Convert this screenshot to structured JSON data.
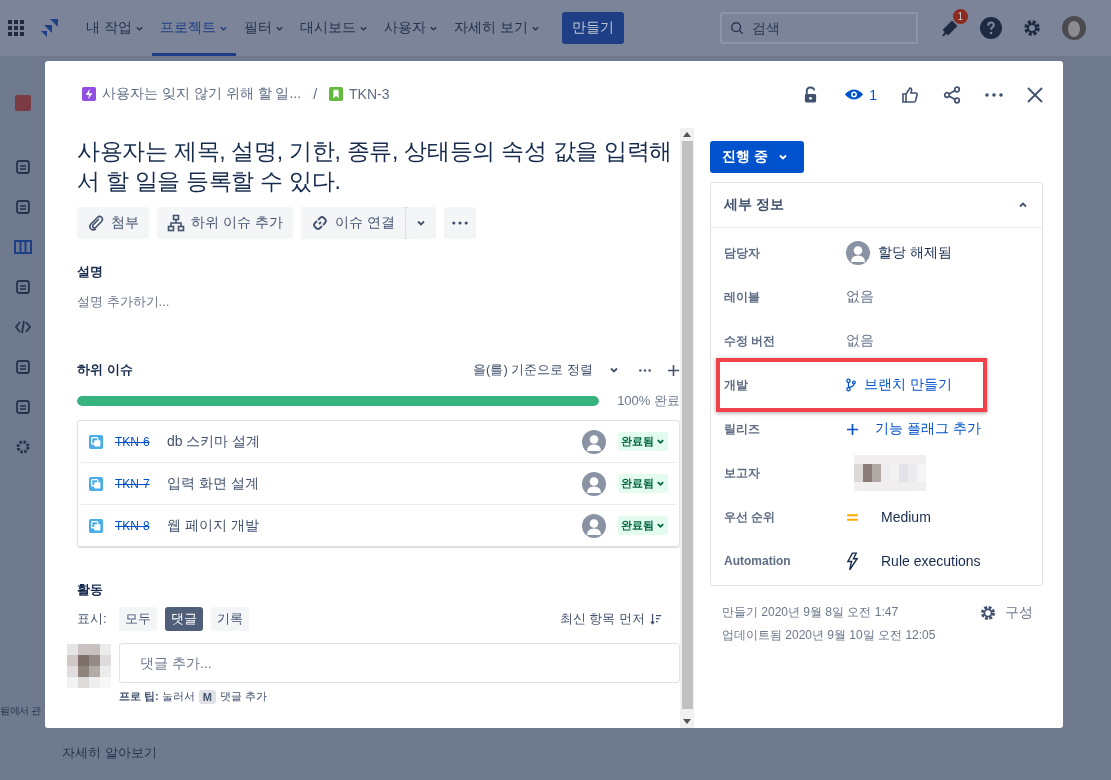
{
  "top_nav": {
    "menus": [
      {
        "label": "내 작업",
        "selected": false
      },
      {
        "label": "프로젝트",
        "selected": true
      },
      {
        "label": "필터",
        "selected": false
      },
      {
        "label": "대시보드",
        "selected": false
      },
      {
        "label": "사용자",
        "selected": false
      },
      {
        "label": "자세히 보기",
        "selected": false
      }
    ],
    "create_button": "만들기",
    "search": {
      "placeholder": "검색"
    },
    "notification_count": "1"
  },
  "background_texts": [
    "됨에서 관",
    "자세히 알아보기"
  ],
  "issue": {
    "breadcrumb": [
      {
        "kind": "epic",
        "label": "사용자는 잊지 않기 위해 할 일..."
      },
      {
        "kind": "story",
        "label": "TKN-3"
      }
    ],
    "breadcrumb_separator": "/",
    "watchers": "1",
    "title": "사용자는 제목, 설명, 기한, 종류, 상태등의 속성 값을 입력해서 할 일을 등록할 수 있다.",
    "actions": [
      {
        "kind": "attach",
        "label": "첨부"
      },
      {
        "kind": "subtask",
        "label": "하위 이슈 추가"
      },
      {
        "kind": "link",
        "label": "이슈 연결"
      }
    ],
    "description": {
      "heading": "설명",
      "prompt": "설명 추가하기..."
    },
    "subtasks": {
      "heading": "하위 이슈",
      "sort_label": "을(를) 기준으로 정렬",
      "level": 1,
      "progress_text": "100% 완료",
      "items": [
        {
          "key": "TKN-6",
          "summary": "db 스키마 설계",
          "status": "완료됨",
          "done": true
        },
        {
          "key": "TKN-7",
          "summary": "입력 화면 설계",
          "status": "완료됨",
          "done": true
        },
        {
          "key": "TKN-8",
          "summary": "웹 페이지 개발",
          "status": "완료됨",
          "done": true
        }
      ]
    },
    "activity": {
      "heading": "활동",
      "show_label": "표시:",
      "filters": [
        {
          "label": "모두",
          "selected": false
        },
        {
          "label": "댓글",
          "selected": true
        },
        {
          "label": "기록",
          "selected": false
        }
      ],
      "order_label": "최신 항목 먼저",
      "comment": {
        "placeholder": "댓글 추가..."
      },
      "tip": {
        "text": "**프로 팁:** 눌러서",
        "key": "M",
        "after": "댓글 추가"
      }
    },
    "status_button": "진행 중",
    "details": {
      "heading": "세부 정보",
      "expanded": true,
      "rows": [
        {
          "label": "담당자",
          "kind": "user",
          "value": "할당 해제됨",
          "highlighted": false
        },
        {
          "label": "레이블",
          "kind": "text",
          "value": "없음",
          "highlighted": false
        },
        {
          "label": "수정 버전",
          "kind": "text",
          "value": "없음",
          "highlighted": false
        },
        {
          "label": "개발",
          "kind": "branch",
          "value": "브랜치 만들기",
          "highlighted": true
        },
        {
          "label": "릴리즈",
          "kind": "add",
          "value": "기능 플래그 추가",
          "highlighted": false
        },
        {
          "label": "보고자",
          "kind": "blurred",
          "highlighted": false
        },
        {
          "label": "우선 순위",
          "kind": "priority",
          "value": "Medium",
          "highlighted": false
        },
        {
          "label": "Automation",
          "kind": "automation",
          "value": "Rule executions",
          "highlighted": false
        }
      ]
    },
    "footer": {
      "created": "만들기 2020년 9월 8일 오전 1:47",
      "updated": "업데이트됨 2020년 9월 10일 오전 12:05",
      "configure": "구성"
    }
  }
}
